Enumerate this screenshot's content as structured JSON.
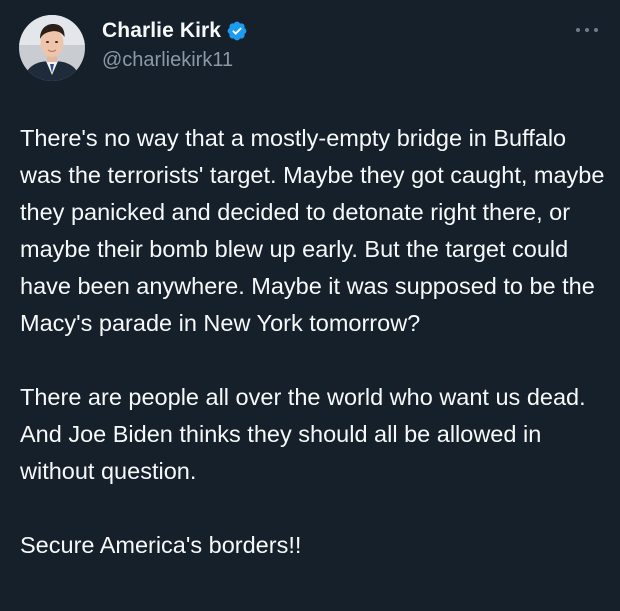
{
  "author": {
    "display_name": "Charlie Kirk",
    "handle": "@charliekirk11",
    "verified_icon": "verified-badge-icon",
    "avatar_icon": "avatar"
  },
  "menu": {
    "icon": "more-options-icon"
  },
  "tweet": {
    "paragraphs": [
      "There's no way that a mostly-empty bridge in Buffalo was the terrorists' target. Maybe they got caught, maybe they panicked and decided to detonate right there, or maybe their bomb blew up early. But the target could have been anywhere. Maybe it was supposed to be the Macy's parade in New York tomorrow?",
      "There are people all over the world who want us dead. And Joe Biden thinks they should all be allowed in without question.",
      "Secure America's borders!!"
    ]
  },
  "colors": {
    "background": "#15202b",
    "text": "#f7f9f9",
    "secondary_text": "#8b98a5",
    "verified_blue": "#1d9bf0"
  }
}
